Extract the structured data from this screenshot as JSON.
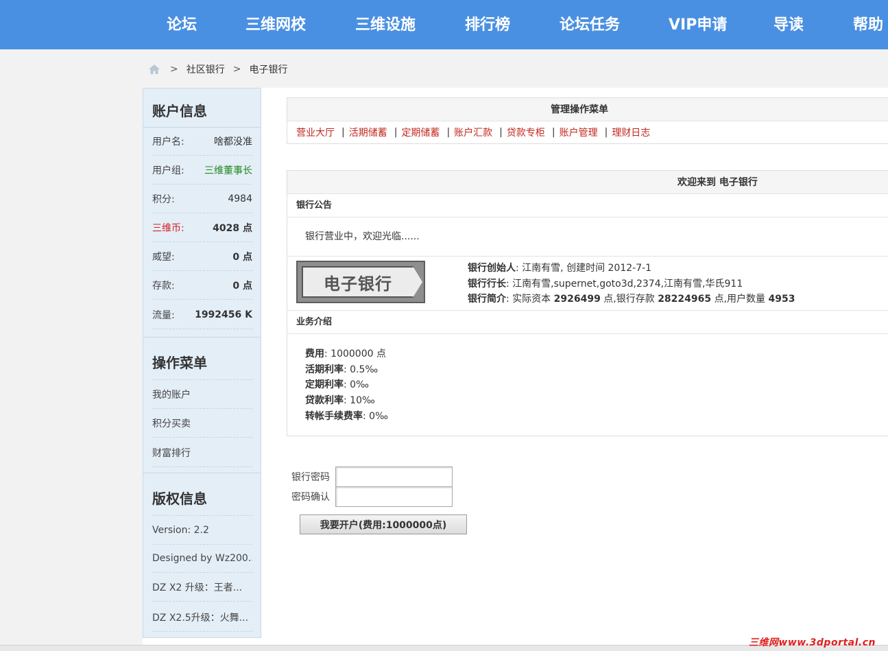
{
  "nav": {
    "items": [
      "论坛",
      "三维网校",
      "三维设施",
      "排行榜",
      "论坛任务",
      "VIP申请",
      "导读",
      "帮助"
    ]
  },
  "breadcrumb": {
    "sep": ">",
    "items": [
      "社区银行",
      "电子银行"
    ]
  },
  "sidebar": {
    "account_title": "账户信息",
    "account": [
      {
        "label": "用户名:",
        "value": "啥都没准"
      },
      {
        "label": "用户组:",
        "value": "三维董事长"
      },
      {
        "label": "积分:",
        "value": "4984"
      },
      {
        "label": "三维币:",
        "value": "4028 点"
      },
      {
        "label": "威望:",
        "value": "0 点"
      },
      {
        "label": "存款:",
        "value": "0 点"
      },
      {
        "label": "流量:",
        "value": "1992456 K"
      }
    ],
    "menu_title": "操作菜单",
    "menu": [
      "我的账户",
      "积分买卖",
      "财富排行"
    ],
    "copyright_title": "版权信息",
    "copyright": [
      "Version: 2.2",
      "Designed by Wz200...",
      "DZ X2 升级：王者...",
      "DZ X2.5升级：火舞..."
    ]
  },
  "manage": {
    "title": "管理操作菜单",
    "sep": "|",
    "links": [
      "营业大厅",
      "活期储蓄",
      "定期储蓄",
      "账户汇款",
      "贷款专柜",
      "账户管理",
      "理财日志"
    ]
  },
  "welcome": {
    "title": "欢迎来到 电子银行",
    "notice_head": "银行公告",
    "notice": "银行营业中，欢迎光临......",
    "logo_text": "电子银行",
    "founder_label": "银行创始人",
    "founder_value": ": 江南有雪, 创建时间 2012-7-1",
    "president_label": "银行行长",
    "president_value": ": 江南有雪,supernet,goto3d,2374,江南有雪,华氏911",
    "intro_label": "银行简介",
    "intro_prefix": ": 实际资本 ",
    "capital": "2926499",
    "intro_mid1": " 点,银行存款 ",
    "deposits": "28224965",
    "intro_mid2": " 点,用户数量 ",
    "users": "4953",
    "business_head": "业务介绍",
    "business": [
      {
        "label": "费用",
        "value": ": 1000000 点"
      },
      {
        "label": "活期利率",
        "value": ": 0.5‰"
      },
      {
        "label": "定期利率",
        "value": ": 0‰"
      },
      {
        "label": "贷款利率",
        "value": ": 10‰"
      },
      {
        "label": "转帐手续费率",
        "value": ": 0‰"
      }
    ]
  },
  "form": {
    "password_label": "银行密码",
    "confirm_label": "密码确认",
    "submit_label": "我要开户(费用:1000000点)"
  },
  "watermark": "三维网www.3dportal.cn"
}
